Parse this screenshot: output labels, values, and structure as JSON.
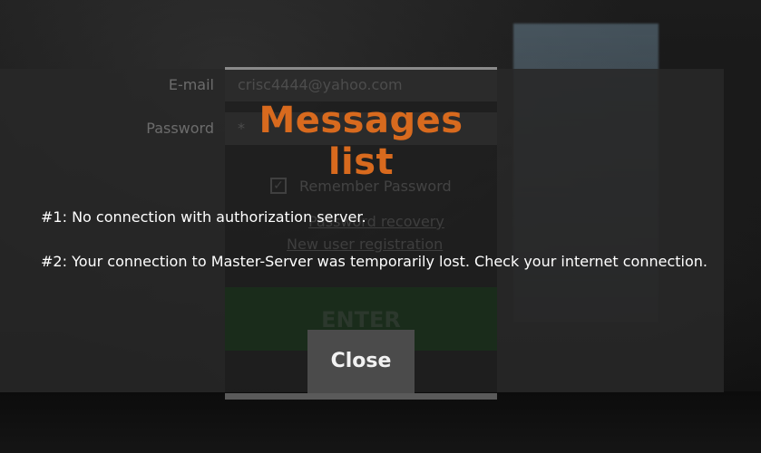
{
  "login": {
    "email_label": "E-mail",
    "email_value": "crisc4444@yahoo.com",
    "password_label": "Password",
    "password_value": "*",
    "remember_label": "Remember Password",
    "recovery_link": "Password recovery",
    "register_link": "New user registration",
    "enter_label": "ENTER"
  },
  "modal": {
    "title": "Messages list",
    "messages": [
      "#1: No connection with authorization server.",
      "#2: Your connection to Master-Server was temporarily lost. Check your internet connection."
    ],
    "close_label": "Close"
  },
  "colors": {
    "title_accent": "#d86a1e",
    "enter_button": "#1f3b21"
  }
}
